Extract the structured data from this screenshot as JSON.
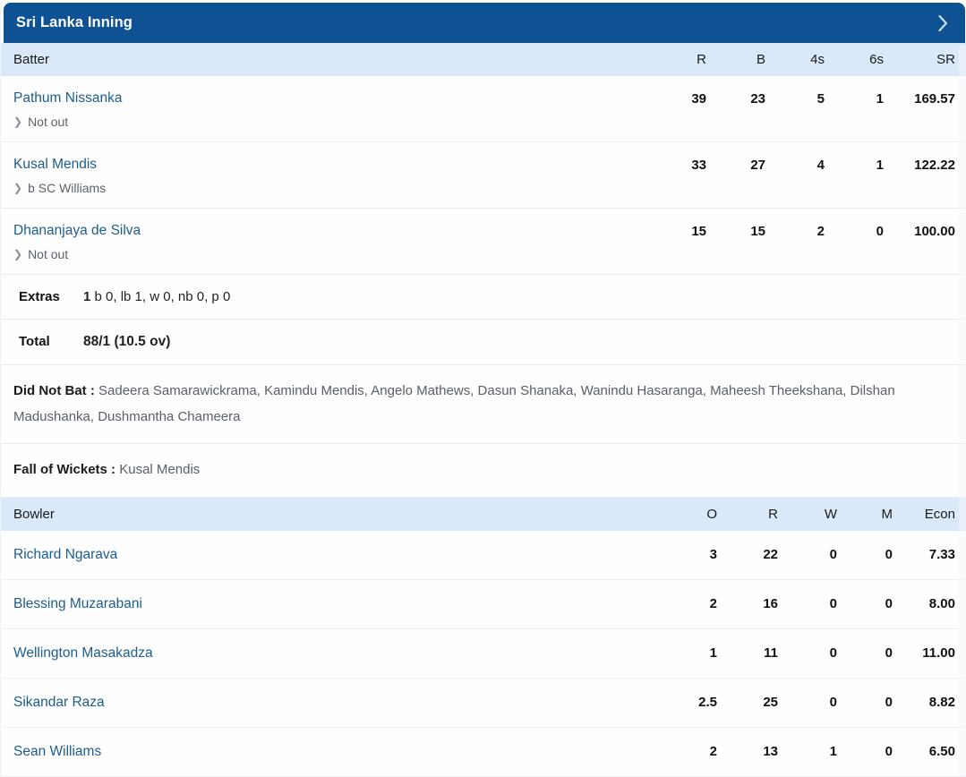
{
  "innings": {
    "title": "Sri Lanka Inning",
    "expand_icon": "chevron-right-icon"
  },
  "batting": {
    "headers": {
      "name": "Batter",
      "r": "R",
      "b": "B",
      "fours": "4s",
      "sixes": "6s",
      "sr": "SR"
    },
    "rows": [
      {
        "name": "Pathum Nissanka",
        "dismissal": "Not out",
        "r": "39",
        "b": "23",
        "fours": "5",
        "sixes": "1",
        "sr": "169.57"
      },
      {
        "name": "Kusal Mendis",
        "dismissal": "b SC Williams",
        "r": "33",
        "b": "27",
        "fours": "4",
        "sixes": "1",
        "sr": "122.22"
      },
      {
        "name": "Dhananjaya de Silva",
        "dismissal": "Not out",
        "r": "15",
        "b": "15",
        "fours": "2",
        "sixes": "0",
        "sr": "100.00"
      }
    ],
    "extras": {
      "label": "Extras",
      "total": "1",
      "breakdown": "b 0, lb 1, w 0, nb 0, p 0"
    },
    "total": {
      "label": "Total",
      "value": "88/1 (10.5 ov)"
    },
    "did_not_bat": {
      "label": "Did Not Bat :",
      "players": "Sadeera Samarawickrama, Kamindu Mendis, Angelo Mathews, Dasun Shanaka, Wanindu Hasaranga, Maheesh Theekshana, Dilshan Madushanka, Dushmantha Chameera"
    },
    "fall_of_wickets": {
      "label": "Fall of Wickets :",
      "value": "Kusal Mendis"
    }
  },
  "bowling": {
    "headers": {
      "name": "Bowler",
      "o": "O",
      "r": "R",
      "w": "W",
      "m": "M",
      "econ": "Econ"
    },
    "rows": [
      {
        "name": "Richard Ngarava",
        "o": "3",
        "r": "22",
        "w": "0",
        "m": "0",
        "econ": "7.33"
      },
      {
        "name": "Blessing Muzarabani",
        "o": "2",
        "r": "16",
        "w": "0",
        "m": "0",
        "econ": "8.00"
      },
      {
        "name": "Wellington Masakadza",
        "o": "1",
        "r": "11",
        "w": "0",
        "m": "0",
        "econ": "11.00"
      },
      {
        "name": "Sikandar Raza",
        "o": "2.5",
        "r": "25",
        "w": "0",
        "m": "0",
        "econ": "8.82"
      },
      {
        "name": "Sean Williams",
        "o": "2",
        "r": "13",
        "w": "1",
        "m": "0",
        "econ": "6.50"
      }
    ]
  },
  "colors": {
    "header_blue": "#0f5294",
    "column_header_blue": "#d9e9f9",
    "link_blue": "#1d5d8e",
    "muted_text": "#5c6268"
  }
}
